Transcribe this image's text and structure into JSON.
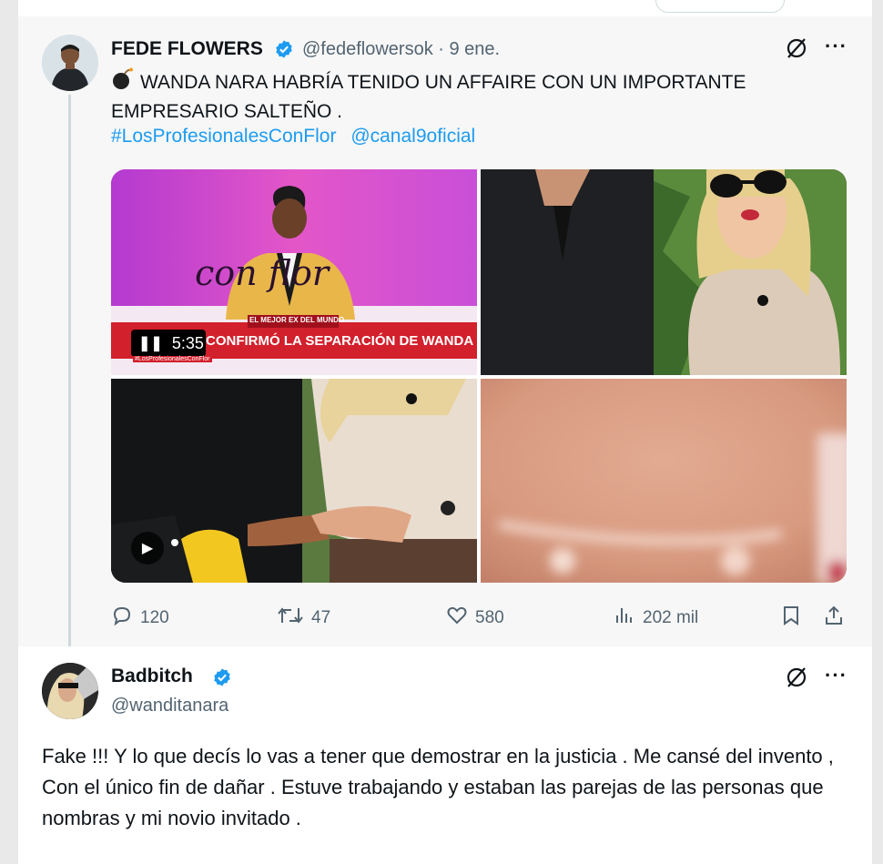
{
  "tweet1": {
    "author_name": "FEDE FLOWERS",
    "handle_and_date": "@fedeflowersok · 9 ene.",
    "text_line1": "WANDA NARA HABRÍA TENIDO UN AFFAIRE CON UN IMPORTANTE",
    "text_line2": "EMPRESARIO SALTEÑO .",
    "hashtag1": "#LosProfesionalesConFlor",
    "hashtag2": "@canal9oficial",
    "video": {
      "banner_small": "EL MEJOR EX DEL MUNDO",
      "banner_text": "CONFIRMÓ LA SEPARACIÓN DE WANDA Y MIGUELES",
      "duration": "5:35",
      "studio_script": "con flor",
      "corner_tag": "#LosProfesionalesConFlor"
    },
    "metrics": {
      "replies": "120",
      "reposts": "47",
      "likes": "580",
      "views": "202 mil"
    }
  },
  "tweet2": {
    "author_name": "Badbitch",
    "handle": "@wanditanara",
    "text": "Fake !!! Y lo que decís lo vas a tener que demostrar en la justicia . Me cansé del invento , Con el único fin de dañar . Estuve trabajando y estaban las parejas de las personas que nombras  y mi novio invitado ."
  },
  "colors": {
    "link_blue": "#1d9bf0",
    "verified_blue": "#1d9bf0",
    "muted_text": "#536471"
  }
}
